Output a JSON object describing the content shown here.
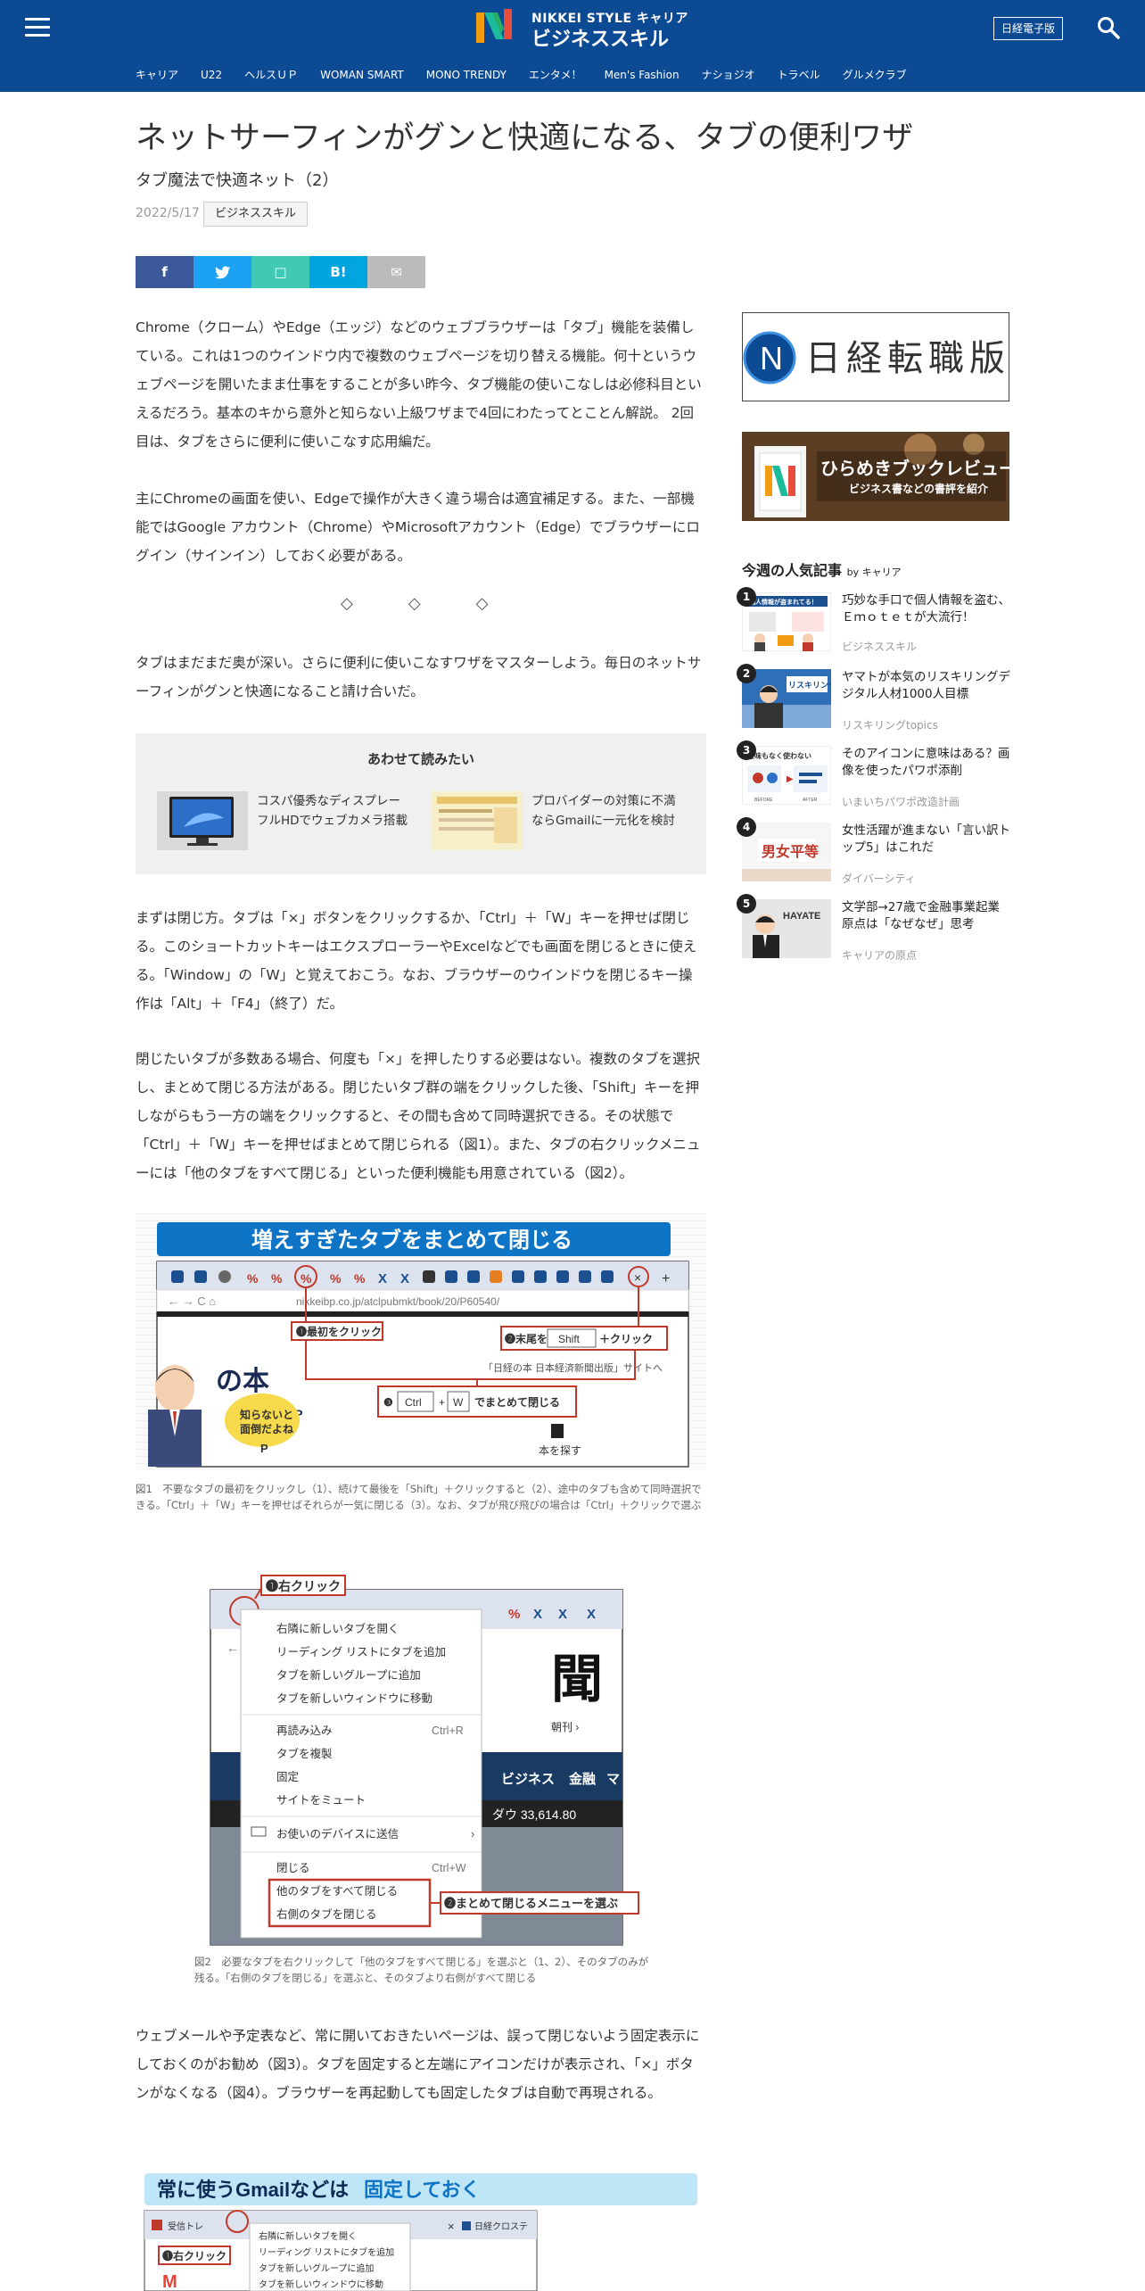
{
  "header": {
    "logo_top": "NIKKEI STYLE キャリア",
    "logo_bottom": "ビジネススキル",
    "epaper": "日経電子版",
    "nav": [
      "キャリア",
      "U22",
      "ヘルスＵＰ",
      "WOMAN SMART",
      "MONO TRENDY",
      "エンタメ！",
      "Men's Fashion",
      "ナショジオ",
      "トラベル",
      "グルメクラブ"
    ]
  },
  "article": {
    "title": "ネットサーフィンがグンと快適になる、タブの便利ワザ",
    "subtitle": "タブ魔法で快適ネット（2）",
    "date": "2022/5/17",
    "tag": "ビジネススキル",
    "share": [
      "f",
      "t",
      "□",
      "B!",
      "✉"
    ],
    "p1": "Chrome（クローム）やEdge（エッジ）などのウェブブラウザーは「タブ」機能を装備している。これは1つのウインドウ内で複数のウェブページを切り替える機能。何十というウェブページを開いたまま仕事をすることが多い昨今、タブ機能の使いこなしは必修科目といえるだろう。基本のキから意外と知らない上級ワザまで4回にわたってとことん解説。 2回目は、タブをさらに便利に使いこなす応用編だ。",
    "p2": "主にChromeの画面を使い、Edgeで操作が大きく違う場合は適宜補足する。また、一部機能ではGoogle アカウント（Chrome）やMicrosoftアカウント（Edge）でブラウザーにログイン（サインイン）しておく必要がある。",
    "diamonds": "◇◇◇",
    "p3": "タブはまだまだ奥が深い。さらに便利に使いこなすワザをマスターしよう。毎日のネットサーフィンがグンと快適になること請け合いだ。",
    "p4": "まずは閉じ方。タブは「×」ボタンをクリックするか、「Ctrl」＋「W」キーを押せば閉じる。このショートカットキーはエクスプローラーやExcelなどでも画面を閉じるときに使える。「Window」の「W」と覚えておこう。なお、ブラウザーのウインドウを閉じるキー操作は「Alt」＋「F4」（終了）だ。",
    "p5": "閉じたいタブが多数ある場合、何度も「×」を押したりする必要はない。複数のタブを選択し、まとめて閉じる方法がある。閉じたいタブ群の端をクリックした後、「Shift」キーを押しながらもう一方の端をクリックすると、その間も含めて同時選択できる。その状態で「Ctrl」＋「W」キーを押せばまとめて閉じられる（図1）。また、タブの右クリックメニューには「他のタブをすべて閉じる」といった便利機能も用意されている（図2）。",
    "p6": "ウェブメールや予定表など、常に開いておきたいページは、誤って閉じないよう固定表示にしておくのがお勧め（図3）。タブを固定すると左端にアイコンだけが表示され、「×」ボタンがなくなる（図4）。ブラウザーを再起動しても固定したタブは自動で再現される。"
  },
  "related": {
    "heading": "あわせて読みたい",
    "items": [
      {
        "text": "コスパ優秀なディスプレー　フルHDでウェブカメラ搭載"
      },
      {
        "text": "プロバイダーの対策に不満ならGmailに一元化を検討"
      }
    ]
  },
  "fig1": {
    "banner": "増えすぎたタブをまとめて閉じる",
    "url": "nikkeibp.co.jp/atclpubmkt/book/20/P60540/",
    "step1": "❶最初をクリック",
    "step2": "❷末尾を",
    "step2_key": "Shift",
    "step2_tail": "＋クリック",
    "step3": "❸",
    "step3_key1": "Ctrl",
    "step3_key2": "W",
    "step3_tail": "でまとめて閉じる",
    "page_text": "「日経の本 日本経済新聞出版」サイトへ",
    "logo_text": "の本",
    "logo_sub": "日経BP",
    "bubble": "知らないと面倒だよね",
    "find_book": "本を探す",
    "caption": "図1　不要なタブの最初をクリックし（1）、続けて最後を「Shift」＋クリックすると（2）、途中のタブも含めて同時選択できる。「Ctrl」＋「W」キーを押せばそれらが一気に閉じる（3）。なお、タブが飛び飛びの場合は「Ctrl」＋クリックで選ぶ"
  },
  "fig2": {
    "step1": "❶右クリック",
    "menu": [
      "右隣に新しいタブを開く",
      "リーディング リストにタブを追加",
      "タブを新しいグループに追加",
      "タブを新しいウィンドウに移動",
      "再読み込み",
      "タブを複製",
      "固定",
      "サイトをミュート",
      "お使いのデバイスに送信",
      "閉じる",
      "他のタブをすべて閉じる",
      "右側のタブを閉じる"
    ],
    "shortcut_reload": "Ctrl+R",
    "shortcut_close": "Ctrl+W",
    "step2": "❷まとめて閉じるメニューを選ぶ",
    "bg_big": "聞",
    "bg_asahi": "朝刊 ›",
    "bg_nav": [
      "ビジネス",
      "金融",
      "マ"
    ],
    "bg_dow": "ダウ 33,614.80",
    "caption": "図2　必要なタブを右クリックして「他のタブをすべて閉じる」を選ぶと（1、2）、そのタブのみが残る。「右側のタブを閉じる」を選ぶと、そのタブより右側がすべて閉じる"
  },
  "fig3": {
    "banner_a": "常に使うGmailなどは",
    "banner_b": "固定しておく",
    "tab1": "受信トレ",
    "tab2": "日経クロステ",
    "step1": "❶右クリック",
    "menu": [
      "右隣に新しいタブを開く",
      "リーディング リストにタブを追加",
      "タブを新しいグループに追加",
      "タブを新しいウィンドウに移動"
    ]
  },
  "sidebar": {
    "ad1": "日経転職版",
    "ad2_title": "ひらめきブックレビュー",
    "ad2_sub": "ビジネス書などの書評を紹介",
    "popular_heading": "今週の人気記事",
    "popular_by": "by キャリア",
    "popular": [
      {
        "num": "1",
        "title": "巧妙な手口で個人情報を盗む、Ｅｍｏｔｅｔが大流行！",
        "cat": "ビジネススキル"
      },
      {
        "num": "2",
        "title": "ヤマトが本気のリスキリングデジタル人材1000人目標",
        "cat": "リスキリングtopics"
      },
      {
        "num": "3",
        "title": "そのアイコンに意味はある？画像を使ったパワポ添削",
        "cat": "いまいちパワポ改造計画"
      },
      {
        "num": "4",
        "title": "女性活躍が進まない「言い訳トップ5」はこれだ",
        "cat": "ダイバーシティ"
      },
      {
        "num": "5",
        "title": "文学部→27歳で金融事業起業原点は「なぜなぜ」思考",
        "cat": "キャリアの原点"
      }
    ],
    "thumb1_banner": "個人情報が盗まれてる！",
    "thumb2_text": "リスキリング",
    "thumb3_text": "意味もなく使わない",
    "thumb3_before": "BEFORE",
    "thumb3_after": "AFTER",
    "thumb4_text": "男女平等",
    "thumb5_text": "HAYATE"
  },
  "colors": {
    "header": "#0c4a93",
    "fb": "#3b5998",
    "tw": "#1da1f2",
    "note": "#41c9b4",
    "hatena": "#00a4de",
    "mail": "#bbbbbb"
  }
}
